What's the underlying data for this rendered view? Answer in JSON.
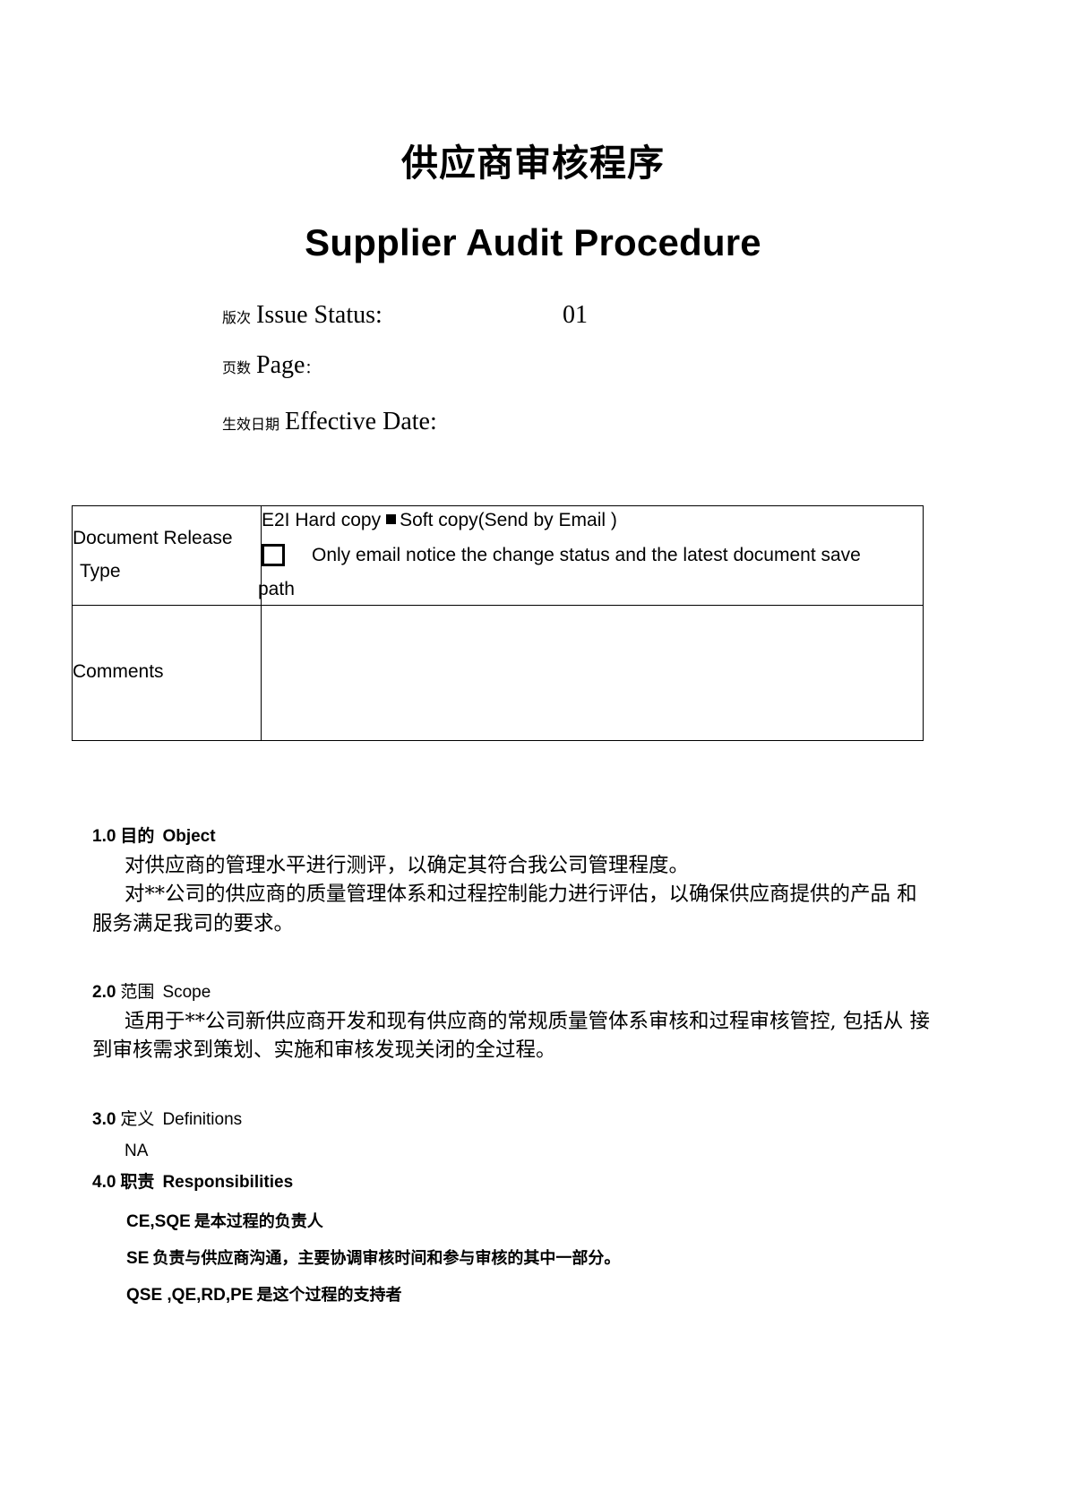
{
  "document": {
    "title_cn": "供应商审核程序",
    "title_en": "Supplier Audit Procedure"
  },
  "meta": {
    "issue_status": {
      "label_cn": "版次",
      "label_en": "Issue Status:",
      "value": "01"
    },
    "page": {
      "label_cn": "页数",
      "label_en": "Page",
      "colon": "：",
      "value": ""
    },
    "effective_date": {
      "label_cn": "生效日期",
      "label_en": "Effective Date:",
      "value": ""
    }
  },
  "table": {
    "rows": [
      {
        "label_line1": "Document Release",
        "label_line2": "Type",
        "content_line1_prefix": "E2I Hard copy",
        "content_line1_suffix": "Soft copy(Send by Email )",
        "content_line2": "Only email notice the change status and the latest document save",
        "content_line3": "path"
      },
      {
        "label": "Comments",
        "content": ""
      }
    ]
  },
  "sections": [
    {
      "number": "1.0",
      "title_cn": "目的",
      "title_en": "Object",
      "bold_cn": true,
      "body": [
        "对供应商的管理水平进行测评，以确定其符合我公司管理程度。",
        "对**公司的供应商的质量管理体系和过程控制能力进行评估，以确保供应商提供的产品 和",
        "服务满足我司的要求。"
      ]
    },
    {
      "number": "2.0",
      "title_cn": "范围",
      "title_en": "Scope",
      "bold_cn": false,
      "body": [
        "适用于**公司新供应商开发和现有供应商的常规质量管体系审核和过程审核管控, 包括从 接",
        "到审核需求到策划、实施和审核发现关闭的全过程。"
      ]
    },
    {
      "number": "3.0",
      "title_cn": "定义",
      "title_en": "Definitions",
      "bold_cn": false,
      "body": [
        "NA"
      ]
    },
    {
      "number": "4.0",
      "title_cn": "职责",
      "title_en": "Responsibilities",
      "bold_cn": true,
      "responsibilities": [
        {
          "role": "CE,SQE",
          "text": "是本过程的负责人"
        },
        {
          "role": "SE",
          "text": "负责与供应商沟通，主要协调审核时间和参与审核的其中一部分。"
        },
        {
          "role": "QSE ,QE,RD,PE",
          "text": "是这个过程的支持者"
        }
      ]
    }
  ]
}
